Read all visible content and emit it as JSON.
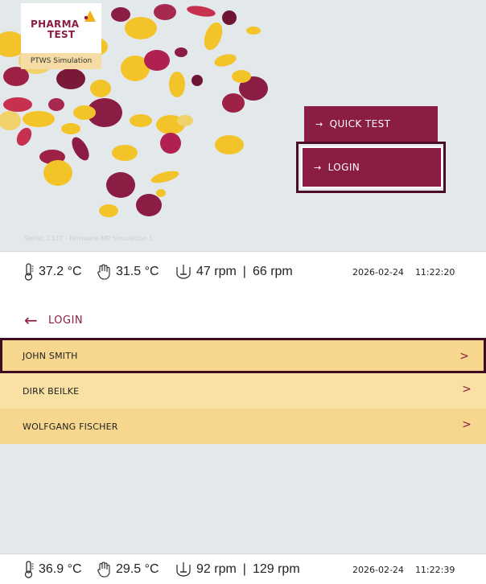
{
  "screen1": {
    "logo": {
      "line1": "PHARMA",
      "line2": "TEST",
      "badge": "PTWS Simulation"
    },
    "buttons": {
      "quick_test": "QUICK TEST",
      "login": "LOGIN",
      "arrow_icon": "arrow-right-icon"
    },
    "serial": "Serial: 1337 - Firmware MP Simulation 1",
    "status": {
      "temp1": "37.2 °C",
      "temp2": "31.5 °C",
      "rpm1": "47 rpm",
      "separator": "|",
      "rpm2": "66 rpm",
      "date": "2026-02-24",
      "time": "11:22:20"
    }
  },
  "screen2": {
    "header": {
      "title": "LOGIN",
      "back_icon": "arrow-left-icon"
    },
    "users": [
      {
        "name": "JOHN SMITH"
      },
      {
        "name": "DIRK BEILKE"
      },
      {
        "name": "WOLFGANG FISCHER"
      }
    ],
    "status": {
      "temp1": "36.9 °C",
      "temp2": "29.5 °C",
      "rpm1": "92 rpm",
      "separator": "|",
      "rpm2": "129 rpm",
      "date": "2026-02-24",
      "time": "11:22:39"
    }
  },
  "colors": {
    "brand": "#8b1d45",
    "accent_yellow": "#f7d78e",
    "background": "#e3e8eb"
  }
}
